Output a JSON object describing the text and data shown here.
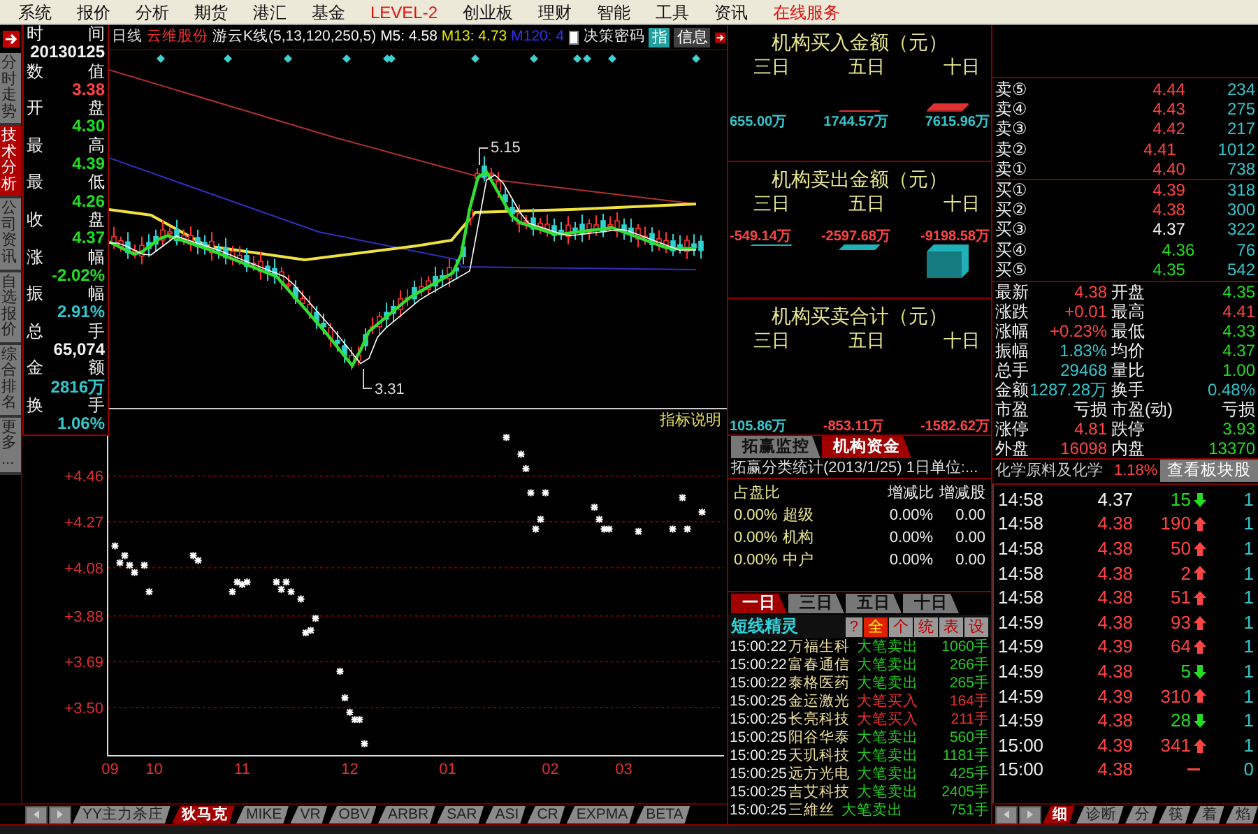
{
  "menu": [
    {
      "label": "系统",
      "emphasis": false
    },
    {
      "label": "报价",
      "emphasis": false
    },
    {
      "label": "分析",
      "emphasis": false
    },
    {
      "label": "期货",
      "emphasis": false
    },
    {
      "label": "港汇",
      "emphasis": false
    },
    {
      "label": "基金",
      "emphasis": false
    },
    {
      "label": "LEVEL-2",
      "emphasis": true
    },
    {
      "label": "创业板",
      "emphasis": false
    },
    {
      "label": "理财",
      "emphasis": false
    },
    {
      "label": "智能",
      "emphasis": false
    },
    {
      "label": "工具",
      "emphasis": false
    },
    {
      "label": "资讯",
      "emphasis": false
    },
    {
      "label": "在线服务",
      "emphasis": true
    }
  ],
  "side_tabs": [
    {
      "label": "分时走势",
      "selected": false
    },
    {
      "label": "技术分析",
      "selected": true
    },
    {
      "label": "公司资讯",
      "selected": false
    },
    {
      "label": "自选报价",
      "selected": false
    },
    {
      "label": "综合排名",
      "selected": false
    },
    {
      "label": "更多...",
      "selected": false
    }
  ],
  "chart_header": {
    "period": "日线",
    "stock": "云维股份",
    "indicator": "游云K线(5,13,120,250,5)",
    "ma_readings": [
      {
        "text": "M5: 4.58",
        "color": "#ffffff"
      },
      {
        "text": "M13: 4.73",
        "color": "#e8e800"
      },
      {
        "text": "M120: 4",
        "color": "#3030ff"
      }
    ],
    "checkbox": {
      "label": "决策密码",
      "checked": false
    },
    "buttons": [
      "指",
      "信息"
    ]
  },
  "info_column": [
    {
      "label_left": "时",
      "label_right": "间",
      "value": "20130125",
      "color": "#f2f2f2"
    },
    {
      "label_left": "数",
      "label_right": "值",
      "value": "3.38",
      "color": "#ff4444"
    },
    {
      "label_left": "开",
      "label_right": "盘",
      "value": "4.30",
      "color": "#22dd22"
    },
    {
      "label_left": "最",
      "label_right": "高",
      "value": "4.39",
      "color": "#22dd22"
    },
    {
      "label_left": "最",
      "label_right": "低",
      "value": "4.26",
      "color": "#22dd22"
    },
    {
      "label_left": "收",
      "label_right": "盘",
      "value": "4.37",
      "color": "#22dd22"
    },
    {
      "label_left": "涨",
      "label_right": "幅",
      "value": "-2.02%",
      "color": "#22dd22"
    },
    {
      "label_left": "振",
      "label_right": "幅",
      "value": "2.91%",
      "color": "#33c6cc"
    },
    {
      "label_left": "总",
      "label_right": "手",
      "value": "65,074",
      "color": "#f2f2f2"
    },
    {
      "label_left": "金",
      "label_right": "额",
      "value": "2816万",
      "color": "#33c6cc"
    },
    {
      "label_left": "换",
      "label_right": "手",
      "value": "1.06%",
      "color": "#33c6cc"
    }
  ],
  "kline": {
    "high_label": "5.15",
    "low_label": "3.31"
  },
  "indicator_note": "指标说明",
  "lower_chart": {
    "chart_data": {
      "type": "scatter",
      "grid": true,
      "ylim": [
        3.3,
        4.69
      ],
      "yticks": [
        {
          "value": 4.46,
          "label": "+4.46"
        },
        {
          "value": 4.27,
          "label": "+4.27"
        },
        {
          "value": 4.08,
          "label": "+4.08"
        },
        {
          "value": 3.88,
          "label": "+3.88"
        },
        {
          "value": 3.69,
          "label": "+3.69"
        },
        {
          "value": 3.5,
          "label": "+3.50"
        }
      ],
      "categories": [
        "09",
        null,
        null,
        null,
        null,
        null,
        null,
        null,
        null,
        "10",
        null,
        null,
        null,
        null,
        null,
        null,
        null,
        null,
        null,
        null,
        null,
        null,
        null,
        null,
        null,
        null,
        null,
        "11",
        null,
        null,
        null,
        null,
        null,
        null,
        null,
        null,
        null,
        null,
        null,
        null,
        null,
        null,
        null,
        null,
        null,
        null,
        null,
        null,
        null,
        "12",
        null,
        null,
        null,
        null,
        null,
        null,
        null,
        null,
        null,
        null,
        null,
        null,
        null,
        null,
        null,
        null,
        null,
        null,
        null,
        "01",
        null,
        null,
        null,
        null,
        null,
        null,
        null,
        null,
        null,
        null,
        null,
        null,
        null,
        null,
        null,
        null,
        null,
        null,
        null,
        null,
        "02",
        null,
        null,
        null,
        null,
        null,
        null,
        null,
        null,
        null,
        null,
        null,
        null,
        null,
        null,
        "03",
        null,
        null,
        null,
        null,
        null,
        null,
        null,
        null,
        null,
        null,
        null,
        null,
        null,
        null,
        null,
        null,
        null,
        null,
        null,
        null
      ],
      "values": [
        null,
        4.17,
        4.1,
        4.13,
        4.09,
        4.06,
        null,
        4.09,
        3.98,
        null,
        null,
        null,
        null,
        null,
        null,
        null,
        null,
        4.13,
        4.11,
        null,
        null,
        null,
        null,
        null,
        null,
        3.98,
        4.02,
        4.01,
        4.02,
        null,
        null,
        null,
        null,
        null,
        4.02,
        3.99,
        4.02,
        3.98,
        null,
        3.95,
        3.81,
        3.82,
        3.87,
        null,
        null,
        null,
        null,
        3.65,
        3.54,
        3.48,
        3.45,
        3.45,
        3.35,
        null,
        null,
        null,
        null,
        null,
        null,
        null,
        null,
        null,
        null,
        null,
        null,
        null,
        null,
        null,
        null,
        null,
        null,
        null,
        null,
        null,
        null,
        null,
        null,
        null,
        null,
        null,
        null,
        4.62,
        null,
        null,
        4.55,
        4.49,
        4.39,
        4.24,
        4.28,
        4.39,
        null,
        null,
        null,
        null,
        null,
        null,
        null,
        null,
        null,
        4.33,
        4.28,
        4.24,
        4.24,
        null,
        null,
        null,
        null,
        null,
        4.23,
        null,
        null,
        null,
        null,
        null,
        null,
        4.24,
        null,
        4.37,
        4.24,
        null,
        null,
        4.31,
        null,
        null,
        null,
        null
      ]
    }
  },
  "indicator_tabs": [
    {
      "label": "YY主力杀庄",
      "selected": false
    },
    {
      "label": "狄马克",
      "selected": true
    },
    {
      "label": "MIKE",
      "selected": false
    },
    {
      "label": "VR",
      "selected": false
    },
    {
      "label": "OBV",
      "selected": false
    },
    {
      "label": "ARBR",
      "selected": false
    },
    {
      "label": "SAR",
      "selected": false
    },
    {
      "label": "ASI",
      "selected": false
    },
    {
      "label": "CR",
      "selected": false
    },
    {
      "label": "EXPMA",
      "selected": false
    },
    {
      "label": "BETA",
      "selected": false
    }
  ],
  "institution_panels": [
    {
      "kind": "buy",
      "title": "机构买入金额（元）",
      "days": [
        "三日",
        "五日",
        "十日"
      ],
      "values": [
        {
          "text": "655.00万",
          "color": "#33c6cc"
        },
        {
          "text": "1744.57万",
          "color": "#33c6cc"
        },
        {
          "text": "7615.96万",
          "color": "#33c6cc"
        }
      ]
    },
    {
      "kind": "sell",
      "title": "机构卖出金额（元）",
      "days": [
        "三日",
        "五日",
        "十日"
      ],
      "values": [
        {
          "text": "-549.14万",
          "color": "#ff4444"
        },
        {
          "text": "-2597.68万",
          "color": "#ff4444"
        },
        {
          "text": "-9198.58万",
          "color": "#ff4444"
        }
      ]
    },
    {
      "kind": "net",
      "title": "机构买卖合计（元）",
      "days": [
        "三日",
        "五日",
        "十日"
      ],
      "values": [
        {
          "text": "105.86万",
          "color": "#33c6cc"
        },
        {
          "text": "-853.11万",
          "color": "#ff4444"
        },
        {
          "text": "-1582.62万",
          "color": "#ff4444"
        }
      ]
    }
  ],
  "panel_tabs": [
    {
      "label": "拓赢监控",
      "selected": false
    },
    {
      "label": "机构资金",
      "selected": true
    }
  ],
  "category_stats": {
    "title": "拓赢分类统计(2013/1/25) 1日单位:...",
    "columns": [
      "占盘比",
      "增减比",
      "增减股"
    ],
    "rows": [
      {
        "share": "0.00%",
        "name": "超级",
        "ratio": "0.00%",
        "shares": "0.00"
      },
      {
        "share": "0.00%",
        "name": "机构",
        "ratio": "0.00%",
        "shares": "0.00"
      },
      {
        "share": "0.00%",
        "name": "中户",
        "ratio": "0.00%",
        "shares": "0.00"
      }
    ]
  },
  "day_tabs": [
    {
      "label": "一日",
      "selected": true
    },
    {
      "label": "三日",
      "selected": false
    },
    {
      "label": "五日",
      "selected": false
    },
    {
      "label": "十日",
      "selected": false
    }
  ],
  "short_term": {
    "title": "短线精灵",
    "buttons": [
      {
        "label": "?",
        "selected": false
      },
      {
        "label": "全",
        "selected": true
      },
      {
        "label": "个",
        "selected": false
      },
      {
        "label": "统",
        "selected": false
      },
      {
        "label": "表",
        "selected": false
      },
      {
        "label": "设",
        "selected": false
      }
    ],
    "items": [
      {
        "time": "15:00:22",
        "name": "万福生科",
        "action": "大笔卖出",
        "kind": "sell",
        "volume": "1060手"
      },
      {
        "time": "15:00:22",
        "name": "富春通信",
        "action": "大笔卖出",
        "kind": "sell",
        "volume": "266手"
      },
      {
        "time": "15:00:22",
        "name": "泰格医药",
        "action": "大笔卖出",
        "kind": "sell",
        "volume": "265手"
      },
      {
        "time": "15:00:25",
        "name": "金运激光",
        "action": "大笔买入",
        "kind": "buy",
        "volume": "164手"
      },
      {
        "time": "15:00:25",
        "name": "长亮科技",
        "action": "大笔买入",
        "kind": "buy",
        "volume": "211手"
      },
      {
        "time": "15:00:25",
        "name": "阳谷华泰",
        "action": "大笔卖出",
        "kind": "sell",
        "volume": "560手"
      },
      {
        "time": "15:00:25",
        "name": "天玑科技",
        "action": "大笔卖出",
        "kind": "sell",
        "volume": "1181手"
      },
      {
        "time": "15:00:25",
        "name": "远方光电",
        "action": "大笔卖出",
        "kind": "sell",
        "volume": "425手"
      },
      {
        "time": "15:00:25",
        "name": "吉艾科技",
        "action": "大笔卖出",
        "kind": "sell",
        "volume": "2405手"
      },
      {
        "time": "15:00:25",
        "name": "三維丝",
        "action": "大笔卖出",
        "kind": "sell",
        "volume": "751手"
      }
    ]
  },
  "order_book": {
    "sells": [
      {
        "label": "卖⑤",
        "price": "4.44",
        "color": "#ff4444",
        "volume": "234"
      },
      {
        "label": "卖④",
        "price": "4.43",
        "color": "#ff4444",
        "volume": "275"
      },
      {
        "label": "卖③",
        "price": "4.42",
        "color": "#ff4444",
        "volume": "217"
      },
      {
        "label": "卖②",
        "price": "4.41",
        "color": "#ff4444",
        "volume": "1012"
      },
      {
        "label": "卖①",
        "price": "4.40",
        "color": "#ff4444",
        "volume": "738"
      }
    ],
    "buys": [
      {
        "label": "买①",
        "price": "4.39",
        "color": "#ff4444",
        "volume": "318"
      },
      {
        "label": "买②",
        "price": "4.38",
        "color": "#ff4444",
        "volume": "300"
      },
      {
        "label": "买③",
        "price": "4.37",
        "color": "#f2f2f2",
        "volume": "322"
      },
      {
        "label": "买④",
        "price": "4.36",
        "color": "#22dd22",
        "volume": "76"
      },
      {
        "label": "买⑤",
        "price": "4.35",
        "color": "#22dd22",
        "volume": "542"
      }
    ]
  },
  "stats": [
    {
      "label": "最新",
      "value": "4.38",
      "color": "#ff4444"
    },
    {
      "label": "开盘",
      "value": "4.35",
      "color": "#22dd22"
    },
    {
      "label": "涨跌",
      "value": "+0.01",
      "color": "#ff4444"
    },
    {
      "label": "最高",
      "value": "4.41",
      "color": "#ff4444"
    },
    {
      "label": "涨幅",
      "value": "+0.23%",
      "color": "#ff4444"
    },
    {
      "label": "最低",
      "value": "4.33",
      "color": "#22dd22"
    },
    {
      "label": "振幅",
      "value": "1.83%",
      "color": "#33c6cc"
    },
    {
      "label": "均价",
      "value": "4.37",
      "color": "#22dd22"
    },
    {
      "label": "总手",
      "value": "29468",
      "color": "#33c6cc"
    },
    {
      "label": "量比",
      "value": "1.00",
      "color": "#22dd22"
    },
    {
      "label": "金额",
      "value": "1287.28万",
      "color": "#33c6cc"
    },
    {
      "label": "换手",
      "value": "0.48%",
      "color": "#33c6cc"
    },
    {
      "label": "市盈",
      "value": "亏损",
      "color": "#f2f2f2"
    },
    {
      "label": "市盈(动)",
      "value": "亏损",
      "color": "#f2f2f2"
    },
    {
      "label": "涨停",
      "value": "4.81",
      "color": "#ff4444"
    },
    {
      "label": "跌停",
      "value": "3.93",
      "color": "#22dd22"
    },
    {
      "label": "外盘",
      "value": "16098",
      "color": "#ff4444"
    },
    {
      "label": "内盘",
      "value": "13370",
      "color": "#22dd22"
    }
  ],
  "sector": {
    "name": "化学原料及化学",
    "change": "1.18%",
    "button": "查看板块股"
  },
  "ticks": [
    {
      "time": "14:58",
      "price": "4.37",
      "color": "#f2f2f2",
      "volume": "15",
      "kind": "down",
      "count": "1"
    },
    {
      "time": "14:58",
      "price": "4.38",
      "color": "#ff4444",
      "volume": "190",
      "kind": "up",
      "count": "1"
    },
    {
      "time": "14:58",
      "price": "4.38",
      "color": "#ff4444",
      "volume": "50",
      "kind": "up",
      "count": "1"
    },
    {
      "time": "14:58",
      "price": "4.38",
      "color": "#ff4444",
      "volume": "2",
      "kind": "up",
      "count": "1"
    },
    {
      "time": "14:58",
      "price": "4.38",
      "color": "#ff4444",
      "volume": "51",
      "kind": "up",
      "count": "1"
    },
    {
      "time": "14:59",
      "price": "4.38",
      "color": "#ff4444",
      "volume": "93",
      "kind": "up",
      "count": "1"
    },
    {
      "time": "14:59",
      "price": "4.39",
      "color": "#ff4444",
      "volume": "64",
      "kind": "up",
      "count": "1"
    },
    {
      "time": "14:59",
      "price": "4.38",
      "color": "#ff4444",
      "volume": "5",
      "kind": "down",
      "count": "1"
    },
    {
      "time": "14:59",
      "price": "4.39",
      "color": "#ff4444",
      "volume": "310",
      "kind": "up",
      "count": "1"
    },
    {
      "time": "14:59",
      "price": "4.38",
      "color": "#ff4444",
      "volume": "28",
      "kind": "down",
      "count": "1"
    },
    {
      "time": "15:00",
      "price": "4.39",
      "color": "#ff4444",
      "volume": "341",
      "kind": "up",
      "count": "1"
    },
    {
      "time": "15:00",
      "price": "4.38",
      "color": "#ff4444",
      "kind": "flat",
      "count": "0"
    }
  ],
  "view_tabs": [
    {
      "label": "细",
      "selected": true
    },
    {
      "label": "诊断",
      "selected": false
    },
    {
      "label": "分",
      "selected": false
    },
    {
      "label": "筷",
      "selected": false
    },
    {
      "label": "着",
      "selected": false
    },
    {
      "label": "焰",
      "selected": false
    }
  ]
}
